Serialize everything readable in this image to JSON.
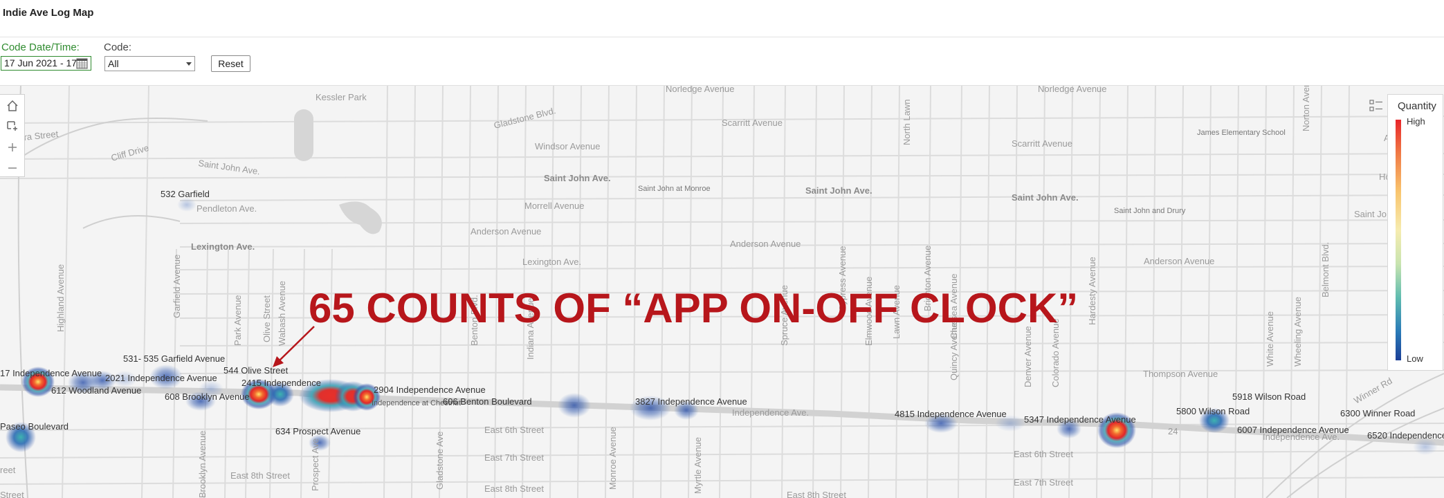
{
  "app_title": "Indie Ave Log Map",
  "filters": {
    "date_label": "Code Date/Time:",
    "date_value": "17 Jun 2021 - 17",
    "code_label": "Code:",
    "code_value": "All",
    "reset_label": "Reset"
  },
  "map_tools": [
    "home-icon",
    "select-area-icon",
    "zoom-in-icon",
    "zoom-out-icon"
  ],
  "layer_toggle": "layer-list-icon",
  "legend": {
    "title": "Quantity",
    "high": "High",
    "low": "Low",
    "colors": [
      "#e8252a",
      "#f9c56e",
      "#5fbcb0",
      "#1b3f97"
    ]
  },
  "callout": {
    "text": "65 COUNTS OF “APP ON-OFF CLOCK”",
    "color": "#b7161b"
  },
  "base_map_labels": [
    "Kessler Park",
    "Norledge Avenue",
    "Norledge Avenue",
    "Gladstone Blvd.",
    "Scarritt Avenue",
    "Scarritt Avenue",
    "ra Street",
    "Cliff Drive",
    "Saint John Ave.",
    "Windsor Avenue",
    "Saint John Ave.",
    "Saint John Ave.",
    "Saint John Ave.",
    "Saint John at Monroe",
    "Saint John and Drury",
    "James Elementary School",
    "Pendleton Ave.",
    "Morrell Avenue",
    "Lexington Ave.",
    "Anderson Avenue",
    "Anderson Avenue",
    "Anderson Avenue",
    "Lexington Ave.",
    "Thompson Avenue",
    "Independence Ave.",
    "Independence Ave.",
    "East 6th Street",
    "East 6th Street",
    "East 7th Street",
    "East 7th Street",
    "East 8th Street",
    "East 8th Street",
    "East 8th Street",
    "Brooklyn Avenue",
    "Prospect Ave",
    "Gladstone Ave",
    "Monroe Avenue",
    "Myrtle Avenue",
    "Benton Blvd.",
    "North Lawn",
    "Brighton Avenue",
    "Belmont Blvd.",
    "Cypress Avenue",
    "Elmwood Avenue",
    "Quincy Avenue",
    "Denver Avenue",
    "Colorado Avenue",
    "White Avenue",
    "Wheeling Avenue",
    "Spruce Avenue",
    "24",
    "Highland Avenue",
    "Garfield Avenue",
    "Park Avenue",
    "Olive Street",
    "Wabash Avenue",
    "Indiana Avenue",
    "Lawn Avenue",
    "Chelsea Avenue",
    "Hardesty Avenue",
    "Norton Avenue",
    "Saint Jo",
    "Ho",
    "A",
    "Street",
    "reet",
    "Winner Rd"
  ],
  "log_points": [
    {
      "label": "17 Independence Avenue",
      "level": 0.95
    },
    {
      "label": "612 Woodland Avenue",
      "level": 0.2
    },
    {
      "label": "2021 Independence Avenue",
      "level": 0.3
    },
    {
      "label": "531- 535 Garfield Avenue",
      "level": 0.15
    },
    {
      "label": "532 Garfield",
      "level": 0.1
    },
    {
      "label": "608 Brooklyn Avenue",
      "level": 0.2
    },
    {
      "label": "544 Olive Street",
      "level": 0.95
    },
    {
      "label": "2415 Independence",
      "level": 0.4
    },
    {
      "label": "2904 Independence Avenue",
      "level": 1.0
    },
    {
      "label": "Independence at Chestnut",
      "level": 0.9
    },
    {
      "label": "606 Benton Boulevard",
      "level": 0.25
    },
    {
      "label": "634 Prospect Avenue",
      "level": 0.2
    },
    {
      "label": "3827 Independence Avenue",
      "level": 0.3
    },
    {
      "label": "4815 Independence Avenue",
      "level": 0.25
    },
    {
      "label": "5347 Independence Avenue",
      "level": 0.95
    },
    {
      "label": "5800 Wilson Road",
      "level": 0.35
    },
    {
      "label": "5918 Wilson Road",
      "level": 0.15
    },
    {
      "label": "6007 Independence Avenue",
      "level": 0.15
    },
    {
      "label": "6300 Winner Road",
      "level": 0.1
    },
    {
      "label": "6520 Independence",
      "level": 0.15
    },
    {
      "label": "Paseo Boulevard",
      "level": 0.45
    }
  ]
}
